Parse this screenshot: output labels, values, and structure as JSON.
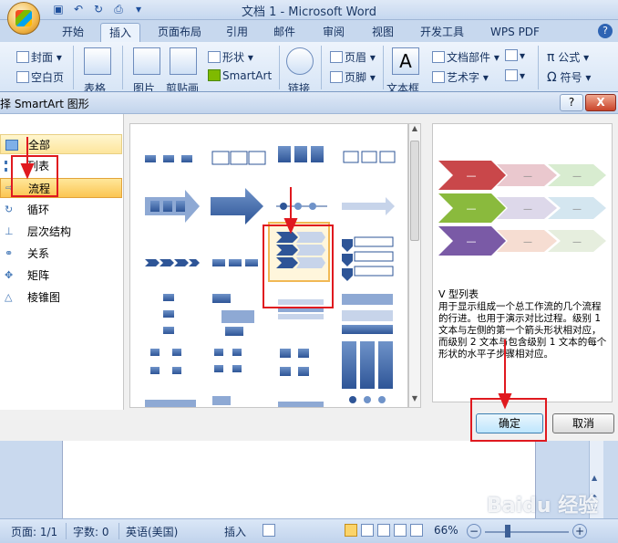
{
  "window": {
    "title": "文档 1 - Microsoft Word"
  },
  "ribbon": {
    "tabs": [
      {
        "label": "开始"
      },
      {
        "label": "插入"
      },
      {
        "label": "页面布局"
      },
      {
        "label": "引用"
      },
      {
        "label": "邮件"
      },
      {
        "label": "审阅"
      },
      {
        "label": "视图"
      },
      {
        "label": "开发工具"
      },
      {
        "label": "WPS PDF"
      }
    ],
    "active_tab": "插入",
    "items": {
      "cover": "封面",
      "blank_page": "空白页",
      "table": "表格",
      "picture": "图片",
      "clipart": "剪贴画",
      "shapes": "形状",
      "smartart": "SmartArt",
      "link": "链接",
      "header": "页眉",
      "footer": "页脚",
      "textbox": "文本框",
      "quick_parts": "文档部件",
      "wordart": "艺术字",
      "equation": "公式",
      "symbol": "符号"
    }
  },
  "dialog": {
    "title": "择 SmartArt 图形",
    "help": "?",
    "close": "X",
    "categories": [
      {
        "label": "全部"
      },
      {
        "label": "列表"
      },
      {
        "label": "流程"
      },
      {
        "label": "循环"
      },
      {
        "label": "层次结构"
      },
      {
        "label": "关系"
      },
      {
        "label": "矩阵"
      },
      {
        "label": "棱锥图"
      }
    ],
    "selected_category": "流程",
    "preview": {
      "name": "V 型列表",
      "description": "用于显示组成一个总工作流的几个流程的行进。也用于演示对比过程。级别 1 文本与左侧的第一个箭头形状相对应，而级别 2 文本与包含级别 1 文本的每个形状的水平子步骤相对应。",
      "placeholder": "—"
    },
    "ok_button": "确定",
    "cancel_button": "取消"
  },
  "statusbar": {
    "page": "页面: 1/1",
    "words": "字数: 0",
    "language": "英语(美国)",
    "mode": "插入",
    "zoom": "66%"
  },
  "watermark": "Baidu 经验",
  "colors": {
    "accent_red": "#e0191f",
    "chevron_red": "#c9474a",
    "chevron_green": "#8aba3d",
    "chevron_purple": "#7a5aa6",
    "selection_gold": "#fbc552"
  }
}
